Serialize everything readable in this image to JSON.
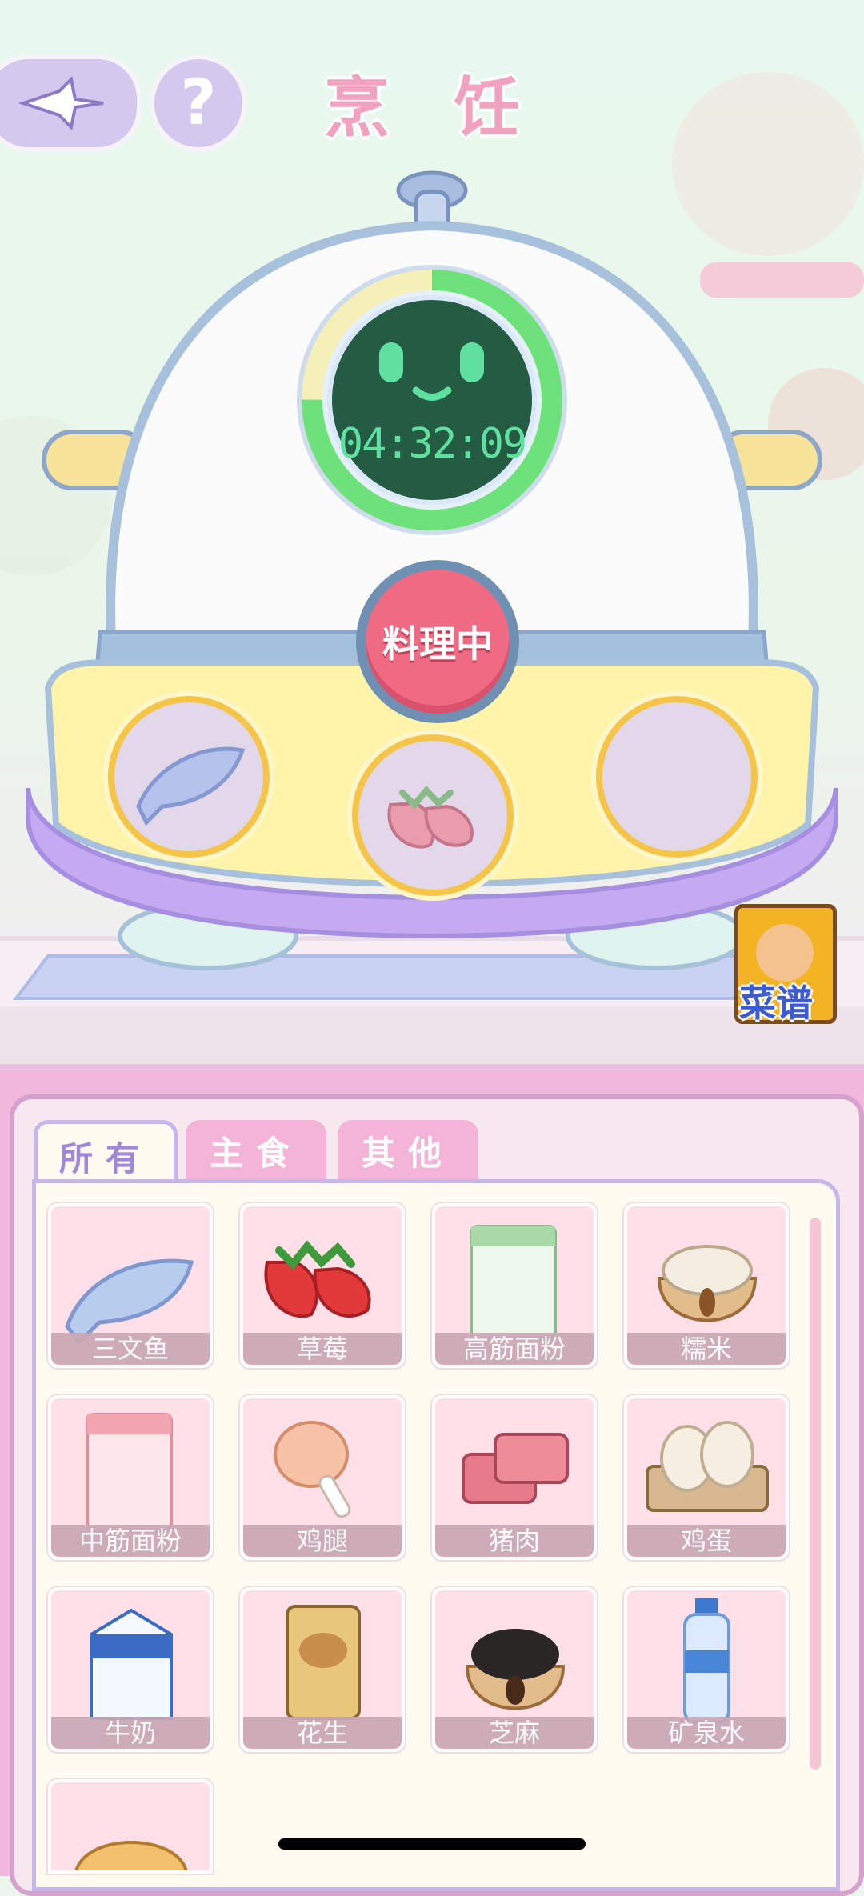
{
  "header": {
    "title": "烹 饪"
  },
  "buttons": {
    "back_icon": "sparkle-back-icon",
    "help_symbol": "?"
  },
  "machine": {
    "timer": "04:32:09",
    "timer_progress": 0.75,
    "status_button": "料理中",
    "slots": [
      {
        "item": "salmon",
        "filled": true
      },
      {
        "item": "strawberry",
        "filled": true
      },
      {
        "item": "",
        "filled": false
      }
    ]
  },
  "recipe_book": {
    "label": "菜谱"
  },
  "tabs": [
    {
      "label": "所有",
      "active": true
    },
    {
      "label": "主食",
      "active": false
    },
    {
      "label": "其他",
      "active": false
    }
  ],
  "ingredients": [
    {
      "name": "三文鱼",
      "icon": "salmon-icon"
    },
    {
      "name": "草莓",
      "icon": "strawberry-icon"
    },
    {
      "name": "高筋面粉",
      "icon": "bread-flour-icon"
    },
    {
      "name": "糯米",
      "icon": "glutinous-rice-icon"
    },
    {
      "name": "中筋面粉",
      "icon": "all-purpose-flour-icon"
    },
    {
      "name": "鸡腿",
      "icon": "chicken-leg-icon"
    },
    {
      "name": "猪肉",
      "icon": "pork-icon"
    },
    {
      "name": "鸡蛋",
      "icon": "eggs-icon"
    },
    {
      "name": "牛奶",
      "icon": "milk-icon"
    },
    {
      "name": "花生",
      "icon": "peanut-icon"
    },
    {
      "name": "芝麻",
      "icon": "sesame-icon"
    },
    {
      "name": "矿泉水",
      "icon": "water-bottle-icon"
    },
    {
      "name": "",
      "icon": "bread-icon"
    }
  ],
  "colors": {
    "accent_pink": "#f0a2bf",
    "timer_green": "#5fe0a0",
    "cook_button": "#ef6a83",
    "panel_pink": "#f2b7dd",
    "tab_active_text": "#a088d8"
  }
}
